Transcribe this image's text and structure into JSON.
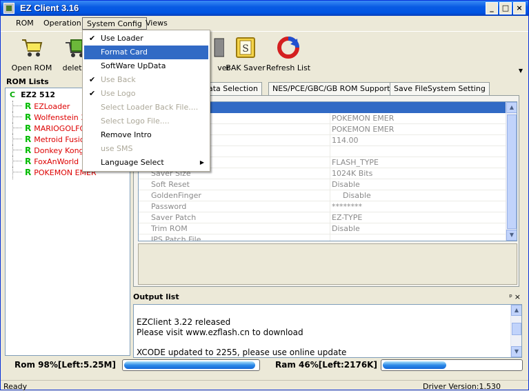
{
  "window": {
    "title": "EZ Client 3.16",
    "controls": {
      "minimize": "_",
      "maximize": "□",
      "close": "×"
    }
  },
  "menubar": {
    "items": [
      {
        "label": "ROM"
      },
      {
        "label": "Operation"
      },
      {
        "label": "System Config"
      },
      {
        "label": "Views"
      }
    ]
  },
  "toolbar": {
    "buttons": [
      {
        "label": "Open ROM",
        "icon": "cart-icon"
      },
      {
        "label": "delete",
        "icon": "delete-cart-icon"
      },
      {
        "label": "ver",
        "icon": "saver-icon"
      },
      {
        "label": "BAK Saver",
        "icon": "bak-saver-icon"
      },
      {
        "label": "Refresh List",
        "icon": "refresh-icon"
      }
    ]
  },
  "system_config_menu": {
    "items": [
      {
        "label": "Use Loader",
        "checked": true,
        "disabled": false,
        "highlighted": false
      },
      {
        "label": "Format Card",
        "checked": false,
        "disabled": false,
        "highlighted": true
      },
      {
        "label": "SoftWare UpData",
        "checked": false,
        "disabled": false,
        "highlighted": false
      },
      {
        "label": "Use Back",
        "checked": true,
        "disabled": true,
        "highlighted": false
      },
      {
        "label": "Use Logo",
        "checked": true,
        "disabled": true,
        "highlighted": false
      },
      {
        "label": "Select Loader Back File....",
        "checked": false,
        "disabled": true,
        "highlighted": false
      },
      {
        "label": "Select Logo File....",
        "checked": false,
        "disabled": true,
        "highlighted": false
      },
      {
        "label": "Remove Intro",
        "checked": false,
        "disabled": false,
        "highlighted": false
      },
      {
        "label": "use SMS",
        "checked": false,
        "disabled": true,
        "highlighted": false
      },
      {
        "label": "Language Select",
        "checked": false,
        "disabled": false,
        "highlighted": false,
        "submenu": true
      }
    ]
  },
  "rom_lists": {
    "header": "ROM Lists",
    "root": {
      "marker": "C",
      "label": "EZ2 512"
    },
    "items": [
      {
        "marker": "R",
        "label": "EZLoader"
      },
      {
        "marker": "R",
        "label": "Wolfenstein 3D"
      },
      {
        "marker": "R",
        "label": "MARIOGOLFGB"
      },
      {
        "marker": "R",
        "label": "Metroid Fusion"
      },
      {
        "marker": "R",
        "label": "Donkey Kong C"
      },
      {
        "marker": "R",
        "label": "FoxAnWorld"
      },
      {
        "marker": "R",
        "label": "POKEMON EMER"
      }
    ]
  },
  "tabs": [
    {
      "label": "d Data Selection"
    },
    {
      "label": "NES/PCE/GBC/GB ROM Support"
    },
    {
      "label": "Save FileSystem Setting"
    }
  ],
  "properties": [
    {
      "key": "e",
      "value": "POKEMON EMER"
    },
    {
      "key": "",
      "value": "POKEMON EMER"
    },
    {
      "key": "",
      "value": "114.00"
    },
    {
      "key": "",
      "value": ""
    },
    {
      "key": "",
      "value": "FLASH_TYPE"
    },
    {
      "key": "Saver Size",
      "value": "1024K Bits"
    },
    {
      "key": "Soft Reset",
      "value": "Disable"
    },
    {
      "key": "GoldenFinger",
      "value": "Disable"
    },
    {
      "key": "Password",
      "value": "********"
    },
    {
      "key": "Saver Patch",
      "value": "EZ-TYPE"
    },
    {
      "key": "Trim ROM",
      "value": "Disable"
    },
    {
      "key": "IPS Patch File",
      "value": ""
    }
  ],
  "output": {
    "title": "Output list",
    "pin": "ᵖ",
    "close": "×",
    "lines": [
      "EZClient 3.22 released",
      "Please visit www.ezflash.cn to download",
      "",
      "XCODE updated to 2255, please use online update"
    ]
  },
  "memory": {
    "rom_label": "Rom 98%[Left:5.25M]",
    "rom_fill": 0.98,
    "ram_label": "Ram 46%[Left:2176K]",
    "ram_fill": 0.46
  },
  "statusbar": {
    "left": "Ready",
    "right": "Driver Version:1.530"
  },
  "colors": {
    "titlebar": "#0054e3",
    "highlight": "#316ac5",
    "rom_name": "#dd0000",
    "marker": "#00bb00"
  }
}
